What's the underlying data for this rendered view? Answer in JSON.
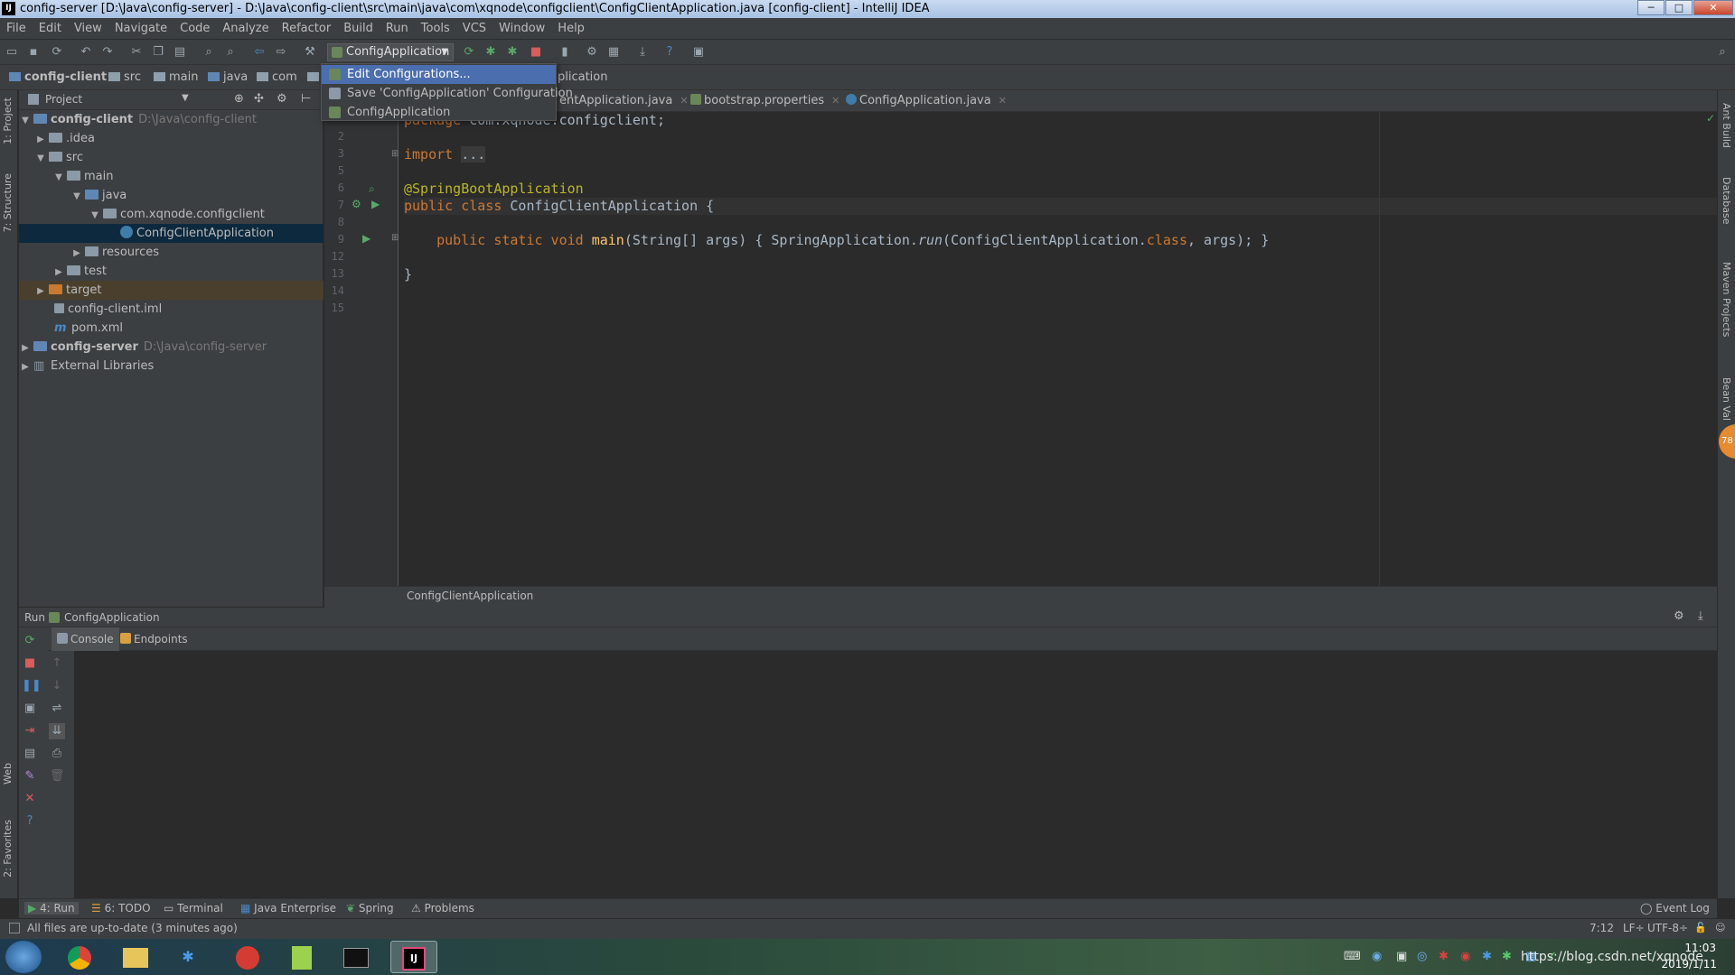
{
  "window": {
    "title": "config-server [D:\\Java\\config-server] - D:\\Java\\config-client\\src\\main\\java\\com\\xqnode\\configclient\\ConfigClientApplication.java [config-client] - IntelliJ IDEA",
    "minimize": "─",
    "maximize": "□",
    "close": "✕"
  },
  "menu": [
    "File",
    "Edit",
    "View",
    "Navigate",
    "Code",
    "Analyze",
    "Refactor",
    "Build",
    "Run",
    "Tools",
    "VCS",
    "Window",
    "Help"
  ],
  "toolbar": {
    "run_config": "ConfigApplication"
  },
  "dropdown": {
    "items": [
      "Edit Configurations...",
      "Save 'ConfigApplication' Configuration",
      "ConfigApplication"
    ]
  },
  "breadcrumb": {
    "items": [
      "config-client",
      "src",
      "main",
      "java",
      "com"
    ],
    "tail": "plication"
  },
  "project_panel": {
    "title": "Project",
    "tree": [
      {
        "label": "config-client",
        "path": "D:\\Java\\config-client"
      },
      {
        "label": ".idea"
      },
      {
        "label": "src"
      },
      {
        "label": "main"
      },
      {
        "label": "java"
      },
      {
        "label": "com.xqnode.configclient"
      },
      {
        "label": "ConfigClientApplication"
      },
      {
        "label": "resources"
      },
      {
        "label": "test"
      },
      {
        "label": "target"
      },
      {
        "label": "config-client.iml"
      },
      {
        "label": "pom.xml"
      },
      {
        "label": "config-server",
        "path": "D:\\Java\\config-server"
      },
      {
        "label": "External Libraries"
      }
    ]
  },
  "editor_tabs": [
    {
      "label": "entApplication.java"
    },
    {
      "label": "bootstrap.properties"
    },
    {
      "label": "ConfigApplication.java"
    }
  ],
  "editor": {
    "line_numbers": [
      "2",
      "3",
      "5",
      "6",
      "7",
      "8",
      "9",
      "12",
      "13",
      "14",
      "15"
    ],
    "code": {
      "l1a": "package ",
      "l1b": "com.xqnode.configclient;",
      "l3a": "import ",
      "l3b": "...",
      "l6a": "@",
      "l6b": "SpringBootApplication",
      "l7a": "public class ",
      "l7b": "ConfigClientApplication {",
      "l9a": "    public static void ",
      "l9b": "main",
      "l9c": "(String[] args) { SpringApplication.",
      "l9d": "run",
      "l9e": "(ConfigClientApplication.",
      "l9f": "class",
      "l9g": ", args); }",
      "l13": "}"
    },
    "breadcrumb": "ConfigClientApplication"
  },
  "run_panel": {
    "title": "Run",
    "config": "ConfigApplication",
    "tabs": [
      "Console",
      "Endpoints"
    ]
  },
  "tool_windows": [
    "4: Run",
    "6: TODO",
    "Terminal",
    "Java Enterprise",
    "Spring",
    "Problems"
  ],
  "event_log": "Event Log",
  "left_strip": [
    "1: Project",
    "7: Structure",
    "Web",
    "2: Favorites"
  ],
  "right_strip": [
    "Ant Build",
    "Database",
    "Maven Projects",
    "Bean Val"
  ],
  "right_badge": "78",
  "status": {
    "message": "All files are up-to-date (3 minutes ago)",
    "position": "7:12",
    "line_sep": "LF÷",
    "encoding": "UTF-8÷"
  },
  "taskbar": {
    "time": "11:03",
    "date": "2019/1/11",
    "watermark": "https://blog.csdn.net/xqnode"
  },
  "colors": {
    "accent": "#4b6eaf",
    "editor_bg": "#2b2b2b",
    "panel_bg": "#3c3f41",
    "keyword": "#cc7832",
    "annotation": "#bbb529"
  }
}
